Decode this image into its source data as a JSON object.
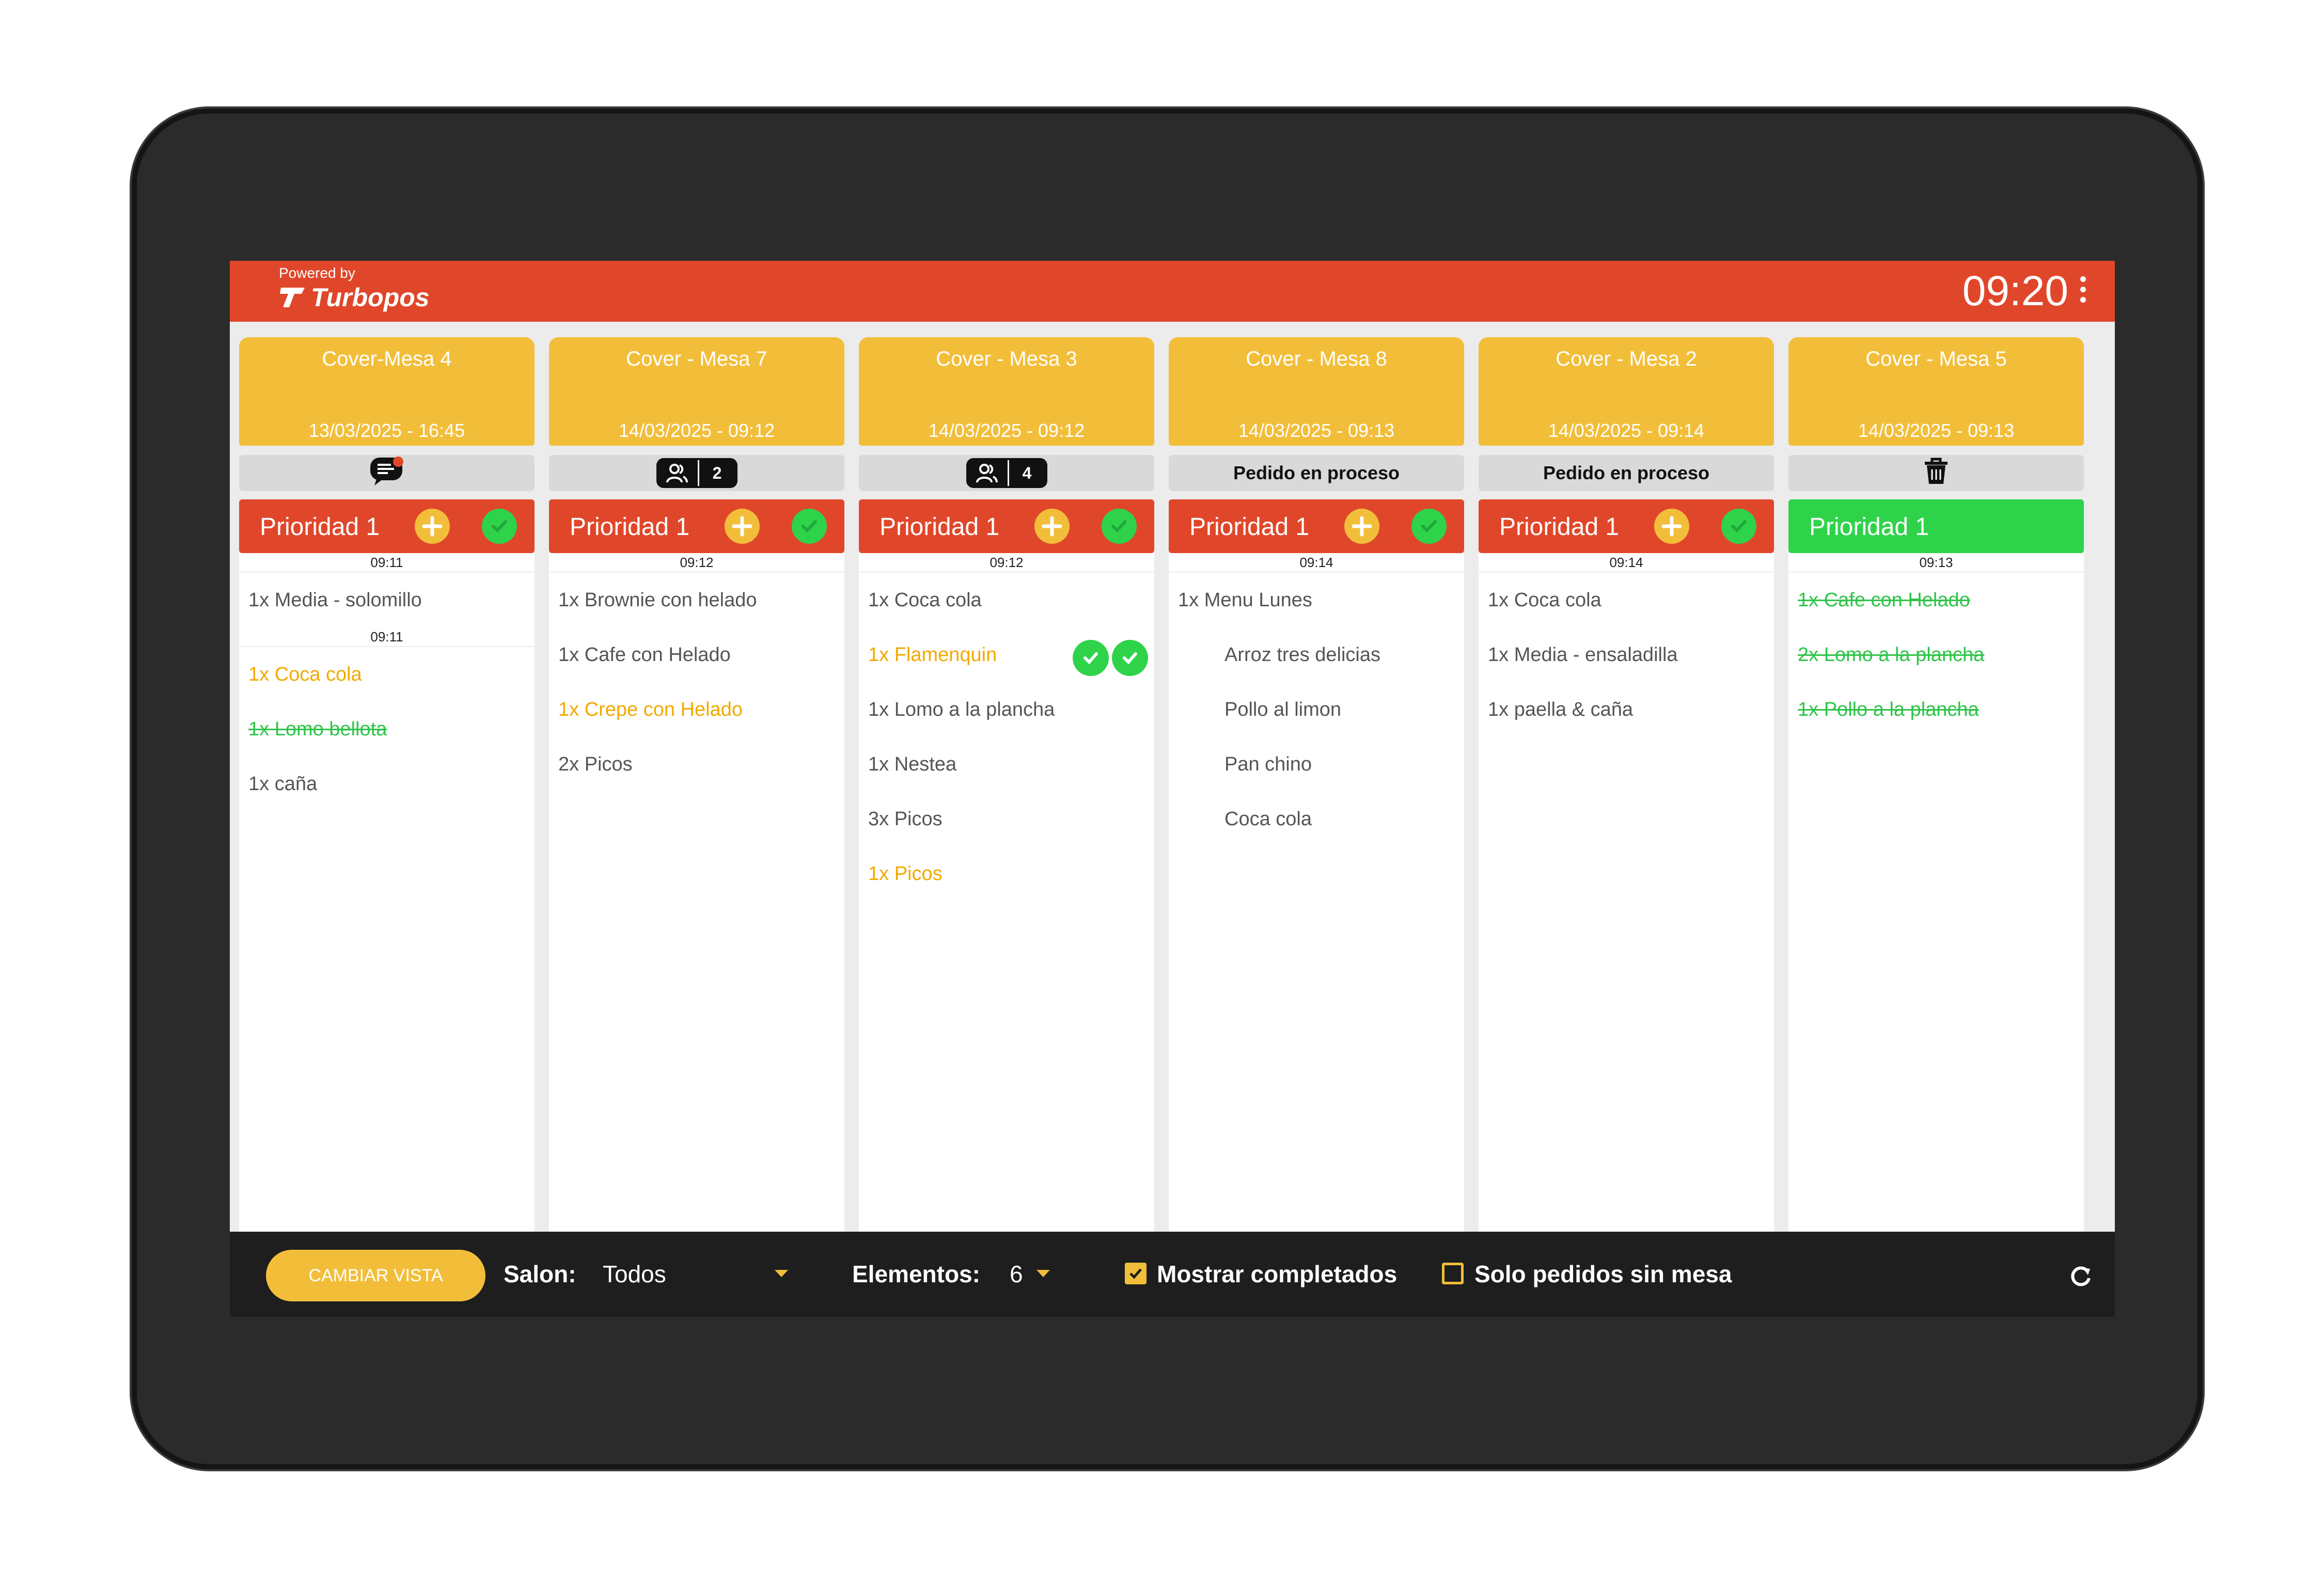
{
  "header": {
    "powered_by": "Powered by",
    "brand": "Turbopos",
    "clock": "09:20"
  },
  "columns": [
    {
      "title": "Cover-Mesa 4",
      "date": "13/03/2025 - 16:45",
      "status": {
        "type": "message-icon"
      },
      "priority": "Prioridad 1",
      "priority_color": "#e0472a",
      "groups": [
        {
          "time": "09:11",
          "items": [
            {
              "text": "1x Media - solomillo",
              "style": "normal"
            }
          ]
        },
        {
          "time": "09:11",
          "items": [
            {
              "text": "1x Coca cola",
              "style": "yellow"
            },
            {
              "text": "1x Lomo bellota",
              "style": "done"
            },
            {
              "text": "1x caña",
              "style": "normal"
            }
          ]
        }
      ]
    },
    {
      "title": "Cover - Mesa 7",
      "date": "14/03/2025 - 09:12",
      "status": {
        "type": "people",
        "count": "2"
      },
      "priority": "Prioridad 1",
      "priority_color": "#e0472a",
      "groups": [
        {
          "time": "09:12",
          "items": [
            {
              "text": "1x Brownie con helado",
              "style": "normal"
            },
            {
              "text": "1x Cafe con Helado",
              "style": "normal"
            },
            {
              "text": "1x Crepe con Helado",
              "style": "yellow"
            },
            {
              "text": "2x Picos",
              "style": "normal"
            }
          ]
        }
      ]
    },
    {
      "title": "Cover - Mesa 3",
      "date": "14/03/2025 - 09:12",
      "status": {
        "type": "people",
        "count": "4"
      },
      "priority": "Prioridad 1",
      "priority_color": "#e0472a",
      "groups": [
        {
          "time": "09:12",
          "items": [
            {
              "text": "1x Coca cola",
              "style": "normal"
            },
            {
              "text": "1x Flamenquin",
              "style": "yellow",
              "checks": 2
            },
            {
              "text": "1x Lomo a la plancha",
              "style": "normal"
            },
            {
              "text": "1x Nestea",
              "style": "normal"
            },
            {
              "text": "3x Picos",
              "style": "normal"
            },
            {
              "text": "1x Picos",
              "style": "yellow"
            }
          ]
        }
      ]
    },
    {
      "title": "Cover - Mesa 8",
      "date": "14/03/2025 - 09:13",
      "status": {
        "type": "text",
        "text": "Pedido en proceso"
      },
      "priority": "Prioridad 1",
      "priority_color": "#e0472a",
      "groups": [
        {
          "time": "09:14",
          "items": [
            {
              "text": "1x Menu Lunes",
              "style": "normal"
            },
            {
              "text": "Arroz tres delicias",
              "style": "indent"
            },
            {
              "text": "Pollo al limon",
              "style": "indent"
            },
            {
              "text": "Pan chino",
              "style": "indent"
            },
            {
              "text": "Coca cola",
              "style": "indent"
            }
          ]
        }
      ]
    },
    {
      "title": "Cover - Mesa 2",
      "date": "14/03/2025 - 09:14",
      "status": {
        "type": "text",
        "text": "Pedido en proceso"
      },
      "priority": "Prioridad 1",
      "priority_color": "#e0472a",
      "groups": [
        {
          "time": "09:14",
          "items": [
            {
              "text": "1x Coca cola",
              "style": "normal"
            },
            {
              "text": "1x Media - ensaladilla",
              "style": "normal"
            },
            {
              "text": "1x paella & caña",
              "style": "normal"
            }
          ]
        }
      ]
    },
    {
      "title": "Cover - Mesa 5",
      "date": "14/03/2025 - 09:13",
      "status": {
        "type": "trash-icon"
      },
      "priority": "Prioridad 1",
      "priority_color": "#2fd34a",
      "groups": [
        {
          "time": "09:13",
          "items": [
            {
              "text": "1x Cafe con Helado",
              "style": "done"
            },
            {
              "text": "2x Lomo a la plancha",
              "style": "done"
            },
            {
              "text": "1x Pollo a la plancha",
              "style": "done"
            }
          ]
        }
      ]
    }
  ],
  "footer": {
    "view_button": "CAMBIAR VISTA",
    "salon_label": "Salon:",
    "salon_value": "Todos",
    "elements_label": "Elementos:",
    "elements_value": "6",
    "show_completed_label": "Mostrar completados",
    "show_completed_checked": true,
    "only_no_table_label": "Solo pedidos sin mesa",
    "only_no_table_checked": false
  },
  "colors": {
    "accent_red": "#e0472a",
    "accent_yellow": "#f2be3a",
    "done_green": "#2fd34a"
  }
}
